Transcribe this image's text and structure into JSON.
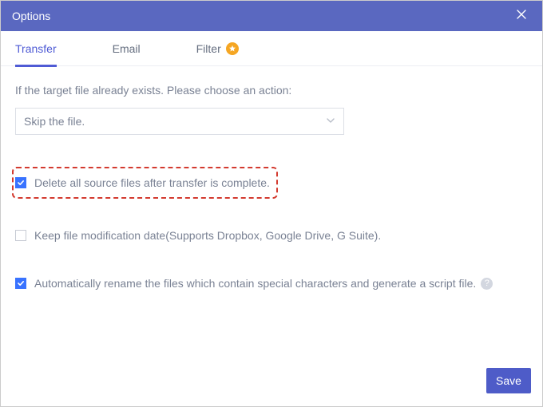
{
  "dialog": {
    "title": "Options"
  },
  "tabs": {
    "transfer": "Transfer",
    "email": "Email",
    "filter": "Filter"
  },
  "content": {
    "instruction": "If the target file already exists. Please choose an action:",
    "select_value": "Skip the file.",
    "opt_delete": "Delete all source files after transfer is complete.",
    "opt_keep_date": "Keep file modification date(Supports Dropbox, Google Drive, G Suite).",
    "opt_autorename": "Automatically rename the files which contain special characters and generate a script file."
  },
  "footer": {
    "save": "Save"
  }
}
